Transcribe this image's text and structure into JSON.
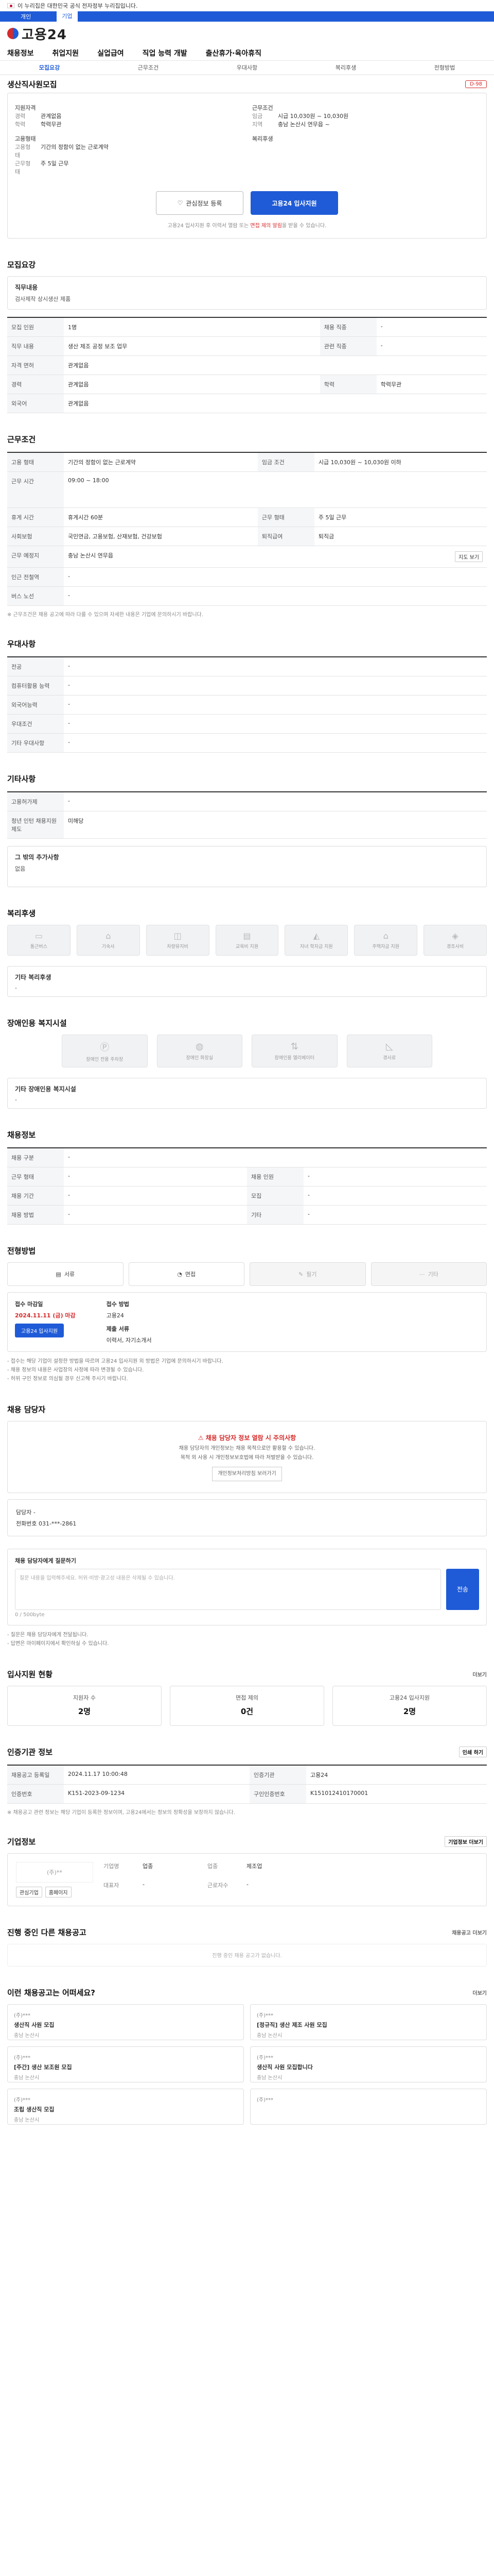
{
  "gov_banner": {
    "text": "이 누리집은 대한민국 공식 전자정부 누리집입니다."
  },
  "blue_bar": {
    "items": [
      "개인",
      "기업"
    ]
  },
  "site": {
    "name": "고용24"
  },
  "gnb": [
    "채용정보",
    "취업지원",
    "실업급여",
    "직업 능력 개발",
    "출산휴가·육아휴직"
  ],
  "subtabs": [
    "모집요강",
    "근무조건",
    "우대사항",
    "복리후생",
    "전형방법"
  ],
  "job": {
    "title": "생산직사원모집",
    "dday": "D-98",
    "summary": {
      "left_title": "지원자격",
      "left_rows": [
        {
          "k": "경력",
          "v": "관계없음"
        },
        {
          "k": "학력",
          "v": "학력무관"
        }
      ],
      "right_title": "근무조건",
      "right_rows": [
        {
          "k": "임금",
          "v": "시급 10,030원 ~ 10,030원"
        },
        {
          "k": "지역",
          "v": "충남 논산시 연무읍 ~"
        }
      ],
      "left_title2": "고용형태",
      "left_rows2": [
        {
          "k": "고용형태",
          "v": "기간의 정함이 없는 근로계약"
        },
        {
          "k": "근무형태",
          "v": "주 5일 근무"
        }
      ],
      "right_title2": "복리후생",
      "right_rows2": []
    },
    "btn_scrap": "관심정보 등록",
    "btn_apply": "고용24 입사지원",
    "apply_note": "고용24 입사지원 후 이력서 열람 또는 ",
    "apply_note_em": "면접 제의 알림",
    "apply_note_tail": "을 받을 수 있습니다."
  },
  "recruit": {
    "title": "모집요강",
    "job_title_label": "직무내용",
    "job_title_value": "검사제작 상시생산 제품",
    "rows": [
      {
        "k1": "모집 인원",
        "v1": "1명",
        "k2": "채용 직종",
        "v2": "-"
      },
      {
        "k1": "직무 내용",
        "v1": "생산 제조 공정 보조 업무",
        "k2": "관련 직종",
        "v2": "-"
      },
      {
        "k1": "자격 면허",
        "v1": "관계없음",
        "k2": "",
        "v2": ""
      },
      {
        "k1": "경력",
        "v1": "관계없음",
        "k2": "학력",
        "v2": "학력무관"
      },
      {
        "k1": "외국어",
        "v1": "관계없음",
        "k2": "",
        "v2": ""
      }
    ]
  },
  "conditions": {
    "title": "근무조건",
    "rows": [
      {
        "k1": "고용 형태",
        "v1": "기간의 정함이 없는 근로계약",
        "k2": "임금 조건",
        "v2": "시급 10,030원 ~ 10,030원 이하"
      },
      {
        "k1": "근무 시간",
        "v1": "09:00 ~ 18:00",
        "k2": "",
        "v2": ""
      },
      {
        "k1": "휴게 시간",
        "v1": "휴게시간 60분",
        "k2": "근무 형태",
        "v2": "주 5일 근무"
      },
      {
        "k1": "사회보험",
        "v1": "국민연금, 고용보험, 산재보험, 건강보험",
        "k2": "퇴직급여",
        "v2": "퇴직금"
      },
      {
        "k1": "근무 예정지",
        "v1": "충남 논산시 연무읍",
        "k2": "",
        "v2": ""
      },
      {
        "k1": "인근 전철역",
        "v1": "-",
        "k2": "",
        "v2": ""
      },
      {
        "k1": "버스 노선",
        "v1": "-",
        "k2": "",
        "v2": ""
      }
    ],
    "map_btn": "지도 보기",
    "note": "※ 근무조건은 채용 공고에 따라 다를 수 있으며 자세한 내용은 기업에 문의하시기 바랍니다."
  },
  "preferences": {
    "title": "우대사항",
    "rows": [
      {
        "k": "전공",
        "v": "-"
      },
      {
        "k": "컴퓨터활용 능력",
        "v": "-"
      },
      {
        "k": "외국어능력",
        "v": "-"
      },
      {
        "k": "우대조건",
        "v": "-"
      },
      {
        "k": "기타 우대사항",
        "v": "-"
      }
    ]
  },
  "others": {
    "title": "기타사항",
    "rows": [
      {
        "k": "고용허가제",
        "v": "-"
      },
      {
        "k": "청년 인턴 채용지원 제도",
        "v": "미해당"
      }
    ],
    "box_title": "그 밖의 추가사항",
    "box_value": "없음"
  },
  "welfare": {
    "title": "복리후생",
    "tiles": [
      "통근버스",
      "기숙사",
      "차량유지비",
      "교육비 지원",
      "자녀 학자금 지원",
      "주택자금 지원",
      "경조사비"
    ],
    "extra_title": "기타 복리후생",
    "extra_value": "-"
  },
  "disabled": {
    "title": "장애인용 복지시설",
    "tiles": [
      "장애인 전용 주차장",
      "장애인 화장실",
      "장애인용 엘리베이터",
      "경사로"
    ],
    "extra_title": "기타 장애인용 복지시설",
    "extra_value": "-"
  },
  "company_info": {
    "title": "채용정보",
    "rows": [
      {
        "k1": "채용 구분",
        "v1": "-",
        "k2": "",
        "v2": ""
      },
      {
        "k1": "근무 형태",
        "v1": "-",
        "k2": "채용 인원",
        "v2": "-"
      },
      {
        "k1": "채용 기간",
        "v1": "-",
        "k2": "모집",
        "v2": "-"
      },
      {
        "k1": "채용 방법",
        "v1": "-",
        "k2": "기타",
        "v2": "-"
      }
    ]
  },
  "screening": {
    "title": "전형방법",
    "methods": [
      "서류",
      "면접",
      "필기",
      "기타"
    ],
    "deadline_label": "접수 마감일",
    "deadline_value": "2024.11.11 (금) 마감",
    "apply_btn": "고용24 입사지원",
    "method_label": "접수 방법",
    "method_value": "고용24",
    "docs_label": "제출 서류",
    "docs_value": "이력서, 자기소개서",
    "bullets": [
      "- 접수는 해당 기업이 설정한 방법을 따르며 고용24 입사지원 외 방법은 기업에 문의하시기 바랍니다.",
      "- 채용 정보의 내용은 사업장의 사정에 따라 변경될 수 있습니다.",
      "- 허위 구인 정보로 의심될 경우 신고해 주시기 바랍니다."
    ]
  },
  "manager": {
    "title": "채용 담당자",
    "warn_title": "채용 담당자 정보 열람 시 주의사항",
    "warn_lines": [
      "채용 담당자의 개인정보는 채용 목적으로만 활용할 수 있습니다.",
      "목적 외 사용 시 개인정보보호법에 따라 처벌받을 수 있습니다."
    ],
    "warn_btn": "개인정보처리방침 보러가기",
    "name_label": "담당자",
    "name_value": "-",
    "phone_label": "전화번호",
    "phone_value": "031-***-2861",
    "msg_title": "채용 담당자에게 질문하기",
    "msg_placeholder": "질문 내용을 입력해주세요. 허위·비방·광고성 내용은 삭제될 수 있습니다.",
    "msg_count": "0 / 500byte",
    "msg_send": "전송",
    "msg_notes": [
      "- 질문은 채용 담당자에게 전달됩니다.",
      "- 답변은 마이페이지에서 확인하실 수 있습니다."
    ]
  },
  "stats": {
    "title": "입사지원 현황",
    "more": "더보기",
    "items": [
      {
        "label": "지원자 수",
        "value": "2명"
      },
      {
        "label": "면접 제의",
        "value": "0건"
      },
      {
        "label": "고용24 입사지원",
        "value": "2명"
      }
    ]
  },
  "info": {
    "title": "인증기관 정보",
    "rows": [
      {
        "k1": "채용공고 등록일",
        "v1": "2024.11.17 10:00:48",
        "k2": "인증기관",
        "v2": "고용24"
      },
      {
        "k1": "인증번호",
        "v1": "K151-2023-09-1234",
        "k2": "구인인증번호",
        "v2": "K151012410170001"
      }
    ],
    "print_btn": "인쇄 하기",
    "note": "※ 채용공고 관련 정보는 해당 기업이 등록한 정보이며, 고용24에서는 정보의 정확성을 보장하지 않습니다."
  },
  "company": {
    "title": "기업정보",
    "name": "(주)**",
    "more": "기업정보 더보기",
    "rows": [
      {
        "k": "기업명",
        "v": "업종"
      },
      {
        "k": "업종",
        "v": "제조업"
      },
      {
        "k": "대표자",
        "v": "-"
      },
      {
        "k": "근로자수",
        "v": "-"
      }
    ],
    "btn1": "관심기업",
    "btn2": "홈페이지"
  },
  "same_company": {
    "title": "진행 중인 다른 채용공고",
    "more": "채용공고 더보기",
    "empty": "진행 중인 채용 공고가 없습니다."
  },
  "recommend": {
    "title": "이런 채용공고는 어떠세요?",
    "more": "더보기",
    "items": [
      {
        "co": "(주)***",
        "t": "생산직 사원 모집",
        "m": "충남 논산시"
      },
      {
        "co": "(주)***",
        "t": "[정규직] 생산 제조 사원 모집",
        "m": "충남 논산시"
      },
      {
        "co": "(주)***",
        "t": "[주간] 생산 보조원 모집",
        "m": "충남 논산시"
      },
      {
        "co": "(주)***",
        "t": "생산직 사원 모집합니다",
        "m": "충남 논산시"
      },
      {
        "co": "(주)***",
        "t": "조립 생산직 모집",
        "m": "충남 논산시"
      },
      {
        "co": "(주)***",
        "t": "",
        "m": ""
      }
    ]
  }
}
